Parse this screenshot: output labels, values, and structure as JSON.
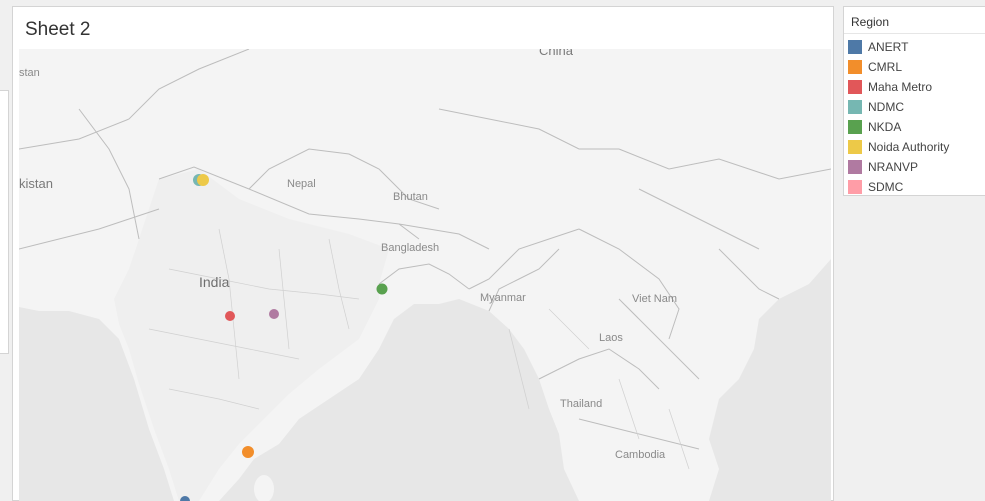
{
  "sheet": {
    "title": "Sheet 2"
  },
  "legend": {
    "title": "Region",
    "items": [
      {
        "label": "ANERT",
        "color": "#4e79a7"
      },
      {
        "label": "CMRL",
        "color": "#f28e2b"
      },
      {
        "label": "Maha Metro",
        "color": "#e15759"
      },
      {
        "label": "NDMC",
        "color": "#76b7b2"
      },
      {
        "label": "NKDA",
        "color": "#59a14f"
      },
      {
        "label": "Noida Authority",
        "color": "#edc948"
      },
      {
        "label": "NRANVP",
        "color": "#b07aa1"
      },
      {
        "label": "SDMC",
        "color": "#ff9da7"
      }
    ]
  },
  "map": {
    "labels": {
      "china": "China",
      "pakistan": "kistan",
      "afghanistan": "stan",
      "nepal": "Nepal",
      "bhutan": "Bhutan",
      "bangladesh": "Bangladesh",
      "india": "India",
      "myanmar": "Myanmar",
      "vietnam": "Viet Nam",
      "laos": "Laos",
      "thailand": "Thailand",
      "cambodia": "Cambodia"
    },
    "markers": [
      {
        "region": "NDMC",
        "color": "#76b7b2"
      },
      {
        "region": "Noida Authority",
        "color": "#edc948"
      },
      {
        "region": "NKDA",
        "color": "#59a14f"
      },
      {
        "region": "Maha Metro",
        "color": "#e15759"
      },
      {
        "region": "NRANVP",
        "color": "#b07aa1"
      },
      {
        "region": "CMRL",
        "color": "#f28e2b"
      },
      {
        "region": "ANERT",
        "color": "#4e79a7"
      }
    ]
  }
}
